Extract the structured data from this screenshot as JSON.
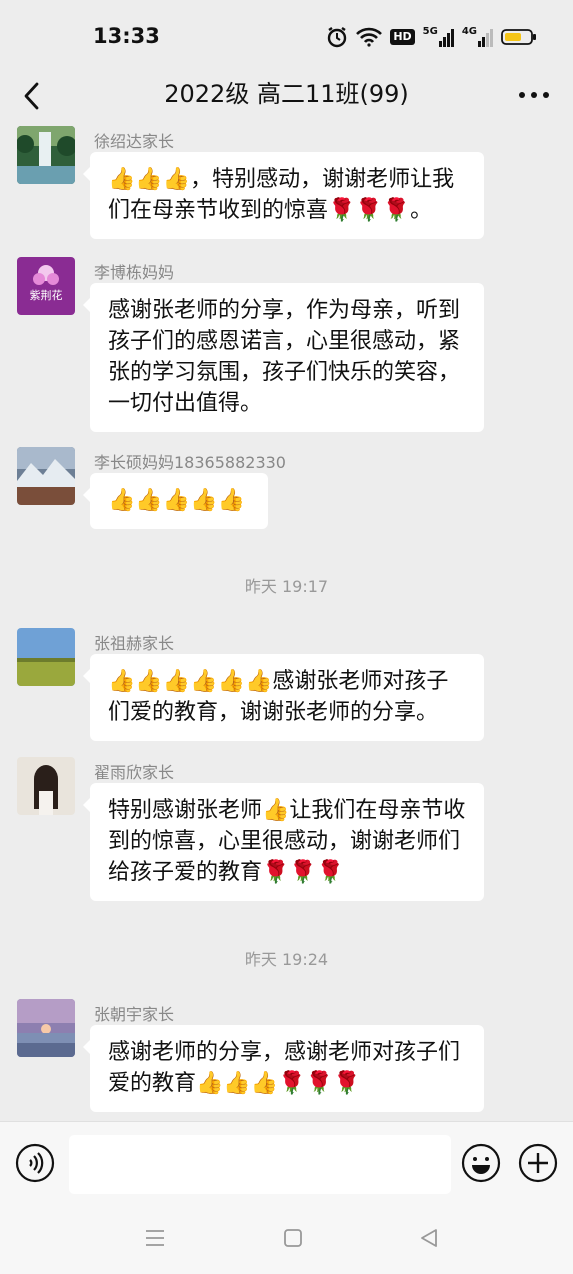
{
  "status_bar": {
    "time": "13:33",
    "icons": [
      "alarm-icon",
      "wifi-icon",
      "hd-icon",
      "signal-5g-icon",
      "signal-4g-icon",
      "battery-icon"
    ],
    "net1": "5G",
    "net2": "4G",
    "hd": "HD"
  },
  "header": {
    "title": "2022级 高二11班(99)",
    "back_icon": "chevron-left-icon",
    "more_icon": "more-dots-icon"
  },
  "messages": [
    {
      "sender": "徐绍达家长",
      "text": "👍👍👍，特别感动，谢谢老师让我们在母亲节收到的惊喜🌹🌹🌹。",
      "avatar": "waterfall"
    },
    {
      "sender": "李博栋妈妈",
      "text": "感谢张老师的分享，作为母亲，听到孩子们的感恩诺言，心里很感动，紧张的学习氛围，孩子们快乐的笑容，一切付出值得。",
      "avatar": "flower",
      "avatar_text": "紫荆花"
    },
    {
      "sender": "李长硕妈妈18365882330",
      "text": "👍👍👍👍👍",
      "avatar": "mountain"
    }
  ],
  "timestamp1": "昨天 19:17",
  "messages2": [
    {
      "sender": "张祖赫家长",
      "text": "👍👍👍👍👍👍感谢张老师对孩子们爱的教育，谢谢张老师的分享。",
      "avatar": "field"
    },
    {
      "sender": "翟雨欣家长",
      "text": "特别感谢张老师👍让我们在母亲节收到的惊喜，心里很感动，谢谢老师们给孩子爱的教育🌹🌹🌹",
      "avatar": "girl"
    }
  ],
  "timestamp2": "昨天 19:24",
  "messages3": [
    {
      "sender": "张朝宇家长",
      "text": "感谢老师的分享，感谢老师对孩子们爱的教育👍👍👍🌹🌹🌹",
      "avatar": "sunset"
    }
  ],
  "input": {
    "placeholder": "",
    "voice_icon": "voice-icon",
    "emoji_icon": "emoji-icon",
    "plus_icon": "plus-icon"
  },
  "system_nav": [
    "menu-icon",
    "home-icon",
    "back-triangle-icon"
  ],
  "colors": {
    "bg": "#ededed",
    "bubble": "#ffffff",
    "thumbs": "#f2b21b",
    "rose": "#d9262e"
  }
}
